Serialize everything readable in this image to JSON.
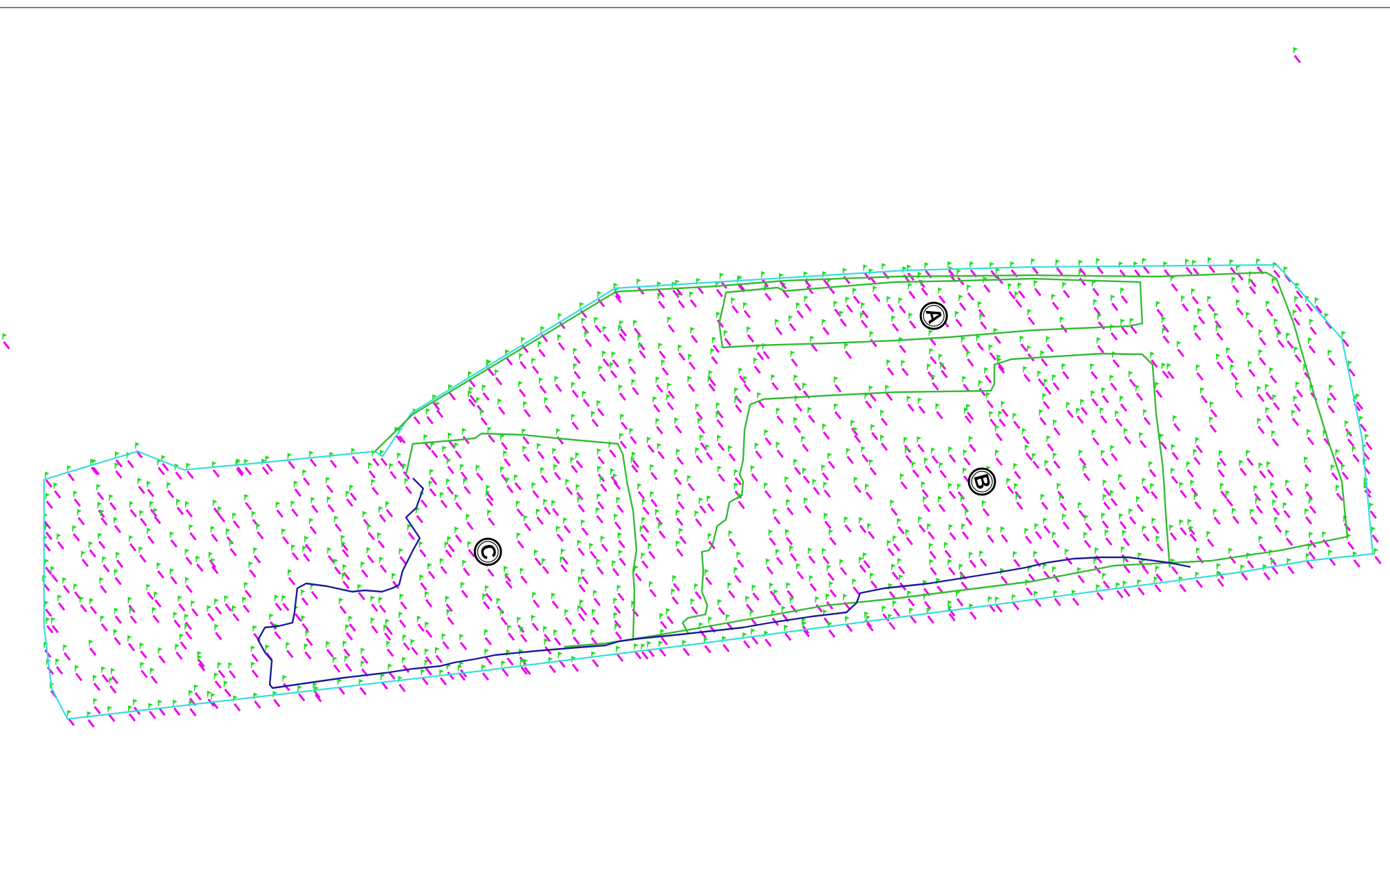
{
  "colors": {
    "background": "#ffffff",
    "site_boundary": "#33dddd",
    "zone_boundary": "#33bb33",
    "water_boundary": "#1a1a99",
    "point_marker": "#22dd22",
    "point_label": "#ee00ee",
    "zone_circle": "#000000"
  },
  "icons": {
    "survey_point": "point-flag-icon",
    "zone_marker": "circled-letter-icon"
  },
  "zones": [
    {
      "id": "zone-a",
      "label": "A"
    },
    {
      "id": "zone-b",
      "label": "B"
    },
    {
      "id": "zone-c",
      "label": "C"
    }
  ]
}
